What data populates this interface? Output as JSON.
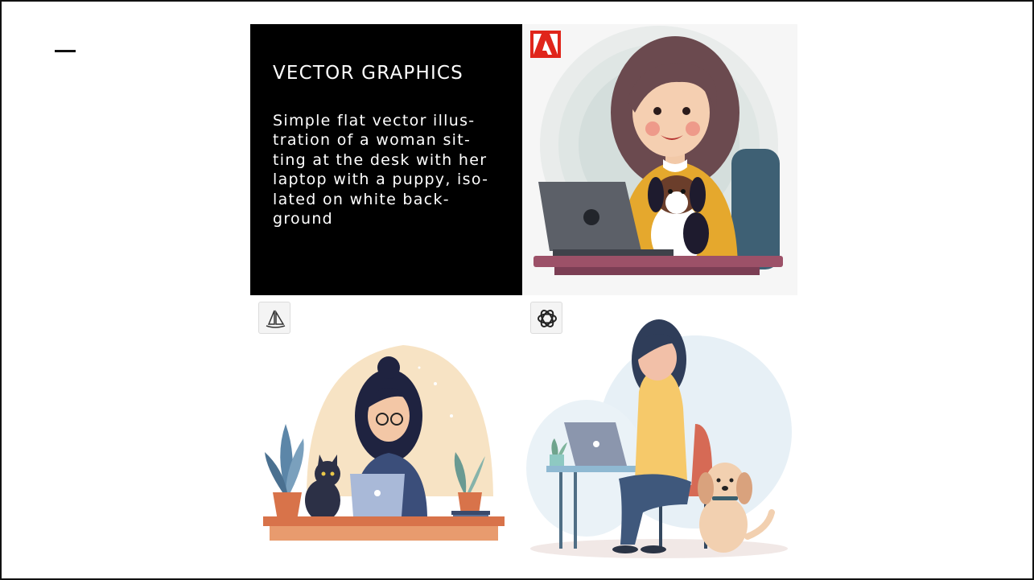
{
  "slide": {
    "heading": "VECTOR GRAPHICS",
    "description_lines": [
      "Simple flat vector illus-",
      "tration of a woman sit-",
      "ting at the desk with her",
      "laptop with a puppy, iso-",
      "lated on white back-",
      "ground"
    ]
  },
  "images": [
    {
      "label": "adobe-firefly-illustration",
      "logo": "adobe-logo-icon"
    },
    {
      "label": "midjourney-illustration",
      "logo": "midjourney-logo-icon"
    },
    {
      "label": "openai-dalle-illustration",
      "logo": "openai-logo-icon"
    }
  ],
  "colors": {
    "text_panel_bg": "#000000",
    "adobe_red": "#e0251b",
    "border": "#111111"
  }
}
